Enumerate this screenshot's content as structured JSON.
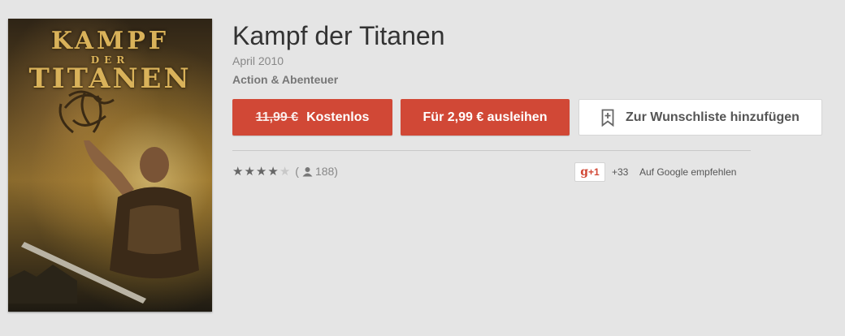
{
  "poster": {
    "title_line1": "KAMPF",
    "title_line2": "DER",
    "title_line3": "TITANEN"
  },
  "movie": {
    "title": "Kampf der Titanen",
    "release": "April 2010",
    "genre": "Action & Abenteuer"
  },
  "actions": {
    "buy_old_price": "11,99 €",
    "buy_label": "Kostenlos",
    "rent_label": "Für 2,99 € ausleihen",
    "wishlist_label": "Zur Wunschliste hinzufügen"
  },
  "rating": {
    "stars_filled": 4,
    "stars_total": 5,
    "paren_open": "(",
    "count": "188",
    "paren_close": ")"
  },
  "social": {
    "gplus_g": "g",
    "gplus_plus": "+1",
    "count": "+33",
    "label": "Auf Google empfehlen"
  },
  "colors": {
    "accent": "#d14836",
    "background": "#e5e5e5"
  },
  "icons": {
    "wishlist": "bookmark-plus-icon",
    "rating_person": "person-icon",
    "star": "star-icon"
  }
}
